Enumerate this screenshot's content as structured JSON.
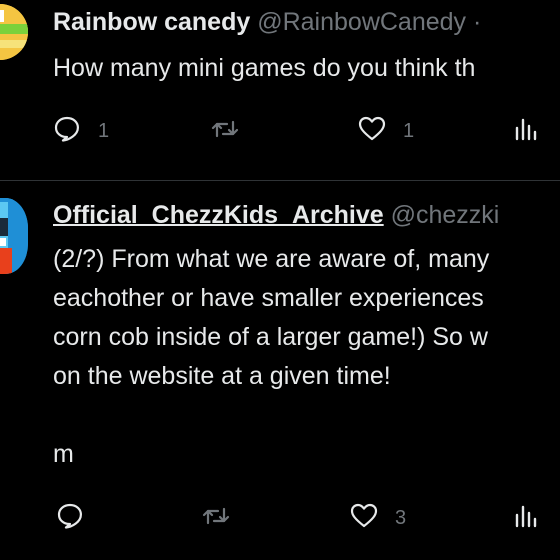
{
  "tweets": [
    {
      "name": "Rainbow canedy",
      "handle": "@RainbowCanedy",
      "separator": "·",
      "lines": [
        "How many mini games do you think th"
      ],
      "stats": {
        "replies": "1",
        "retweets": "",
        "likes": "1",
        "views": ""
      }
    },
    {
      "name": "Official_ChezzKids_Archive",
      "handle": "@chezzki",
      "separator": "",
      "lines": [
        "(2/?) From what we are aware of, many",
        "eachother or have smaller experiences",
        "corn cob inside of a larger game!) So w",
        "on the website at a given time!",
        "",
        "m"
      ],
      "stats": {
        "replies": "",
        "retweets": "",
        "likes": "3",
        "views": ""
      }
    }
  ],
  "icons": {
    "reply": "reply-icon",
    "retweet": "retweet-icon",
    "like": "like-icon",
    "views": "views-icon"
  },
  "colors": {
    "background": "#000000",
    "text": "#e7e9ea",
    "muted": "#71767b",
    "divider": "#2f3336"
  }
}
